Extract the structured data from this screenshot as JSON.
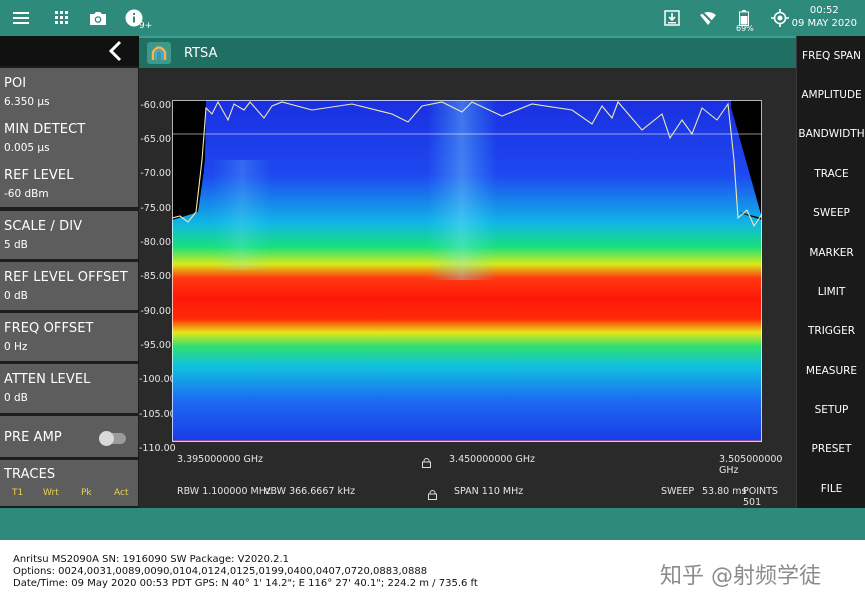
{
  "statusbar": {
    "info_badge": "9+",
    "battery_percent": "69%",
    "time": "00:52",
    "date": "09 MAY 2020"
  },
  "left_panel": {
    "items": [
      {
        "label": "POI",
        "value": "6.350 µs"
      },
      {
        "label": "MIN DETECT",
        "value": "0.005 µs"
      },
      {
        "label": "REF LEVEL",
        "value": "-60 dBm"
      },
      {
        "label": "SCALE / DIV",
        "value": "5 dB"
      },
      {
        "label": "REF LEVEL OFFSET",
        "value": "0 dB"
      },
      {
        "label": "FREQ OFFSET",
        "value": "0 Hz"
      },
      {
        "label": "ATTEN LEVEL",
        "value": "0 dB"
      }
    ],
    "preamp_label": "PRE AMP",
    "preamp_on": false,
    "traces_label": "TRACES",
    "trace_tabs": [
      "T1",
      "Wrt",
      "Pk",
      "Act"
    ]
  },
  "title_bar": {
    "title": "RTSA"
  },
  "plot": {
    "y_ticks": [
      "-60.00",
      "-65.00",
      "-70.00",
      "-75.00",
      "-80.00",
      "-85.00",
      "-90.00",
      "-95.00",
      "-100.00",
      "-105.00",
      "-110.00"
    ],
    "x_start": "3.395000000 GHz",
    "x_center": "3.450000000 GHz",
    "x_stop": "3.505000000 GHz",
    "rbw": "RBW 1.100000 MHz",
    "vbw": "VBW 366.6667 kHz",
    "span": "SPAN 110 MHz",
    "sweep": "SWEEP",
    "sweep_time": "53.80 ms",
    "points": "POINTS 501"
  },
  "right_menu": [
    "FREQ SPAN",
    "AMPLITUDE",
    "BANDWIDTH",
    "TRACE",
    "SWEEP",
    "MARKER",
    "LIMIT",
    "TRIGGER",
    "MEASURE",
    "SETUP",
    "PRESET",
    "FILE"
  ],
  "footer": {
    "line1": "Anritsu MS2090A SN: 1916090 SW Package: V2020.2.1",
    "line2": "Options: 0024,0031,0089,0090,0104,0124,0125,0199,0400,0407,0720,0883,0888",
    "line3": "Date/Time: 09 May 2020 00:53 PDT GPS: N 40° 1' 14.2\"; E 116° 27' 40.1\"; 224.2 m / 735.6 ft"
  },
  "watermark": "知乎 @射频学徒",
  "colors": {
    "teal": "#2e8a7b",
    "panel_item": "#5d5d5d",
    "trace_yellow": "#e6d34a"
  }
}
